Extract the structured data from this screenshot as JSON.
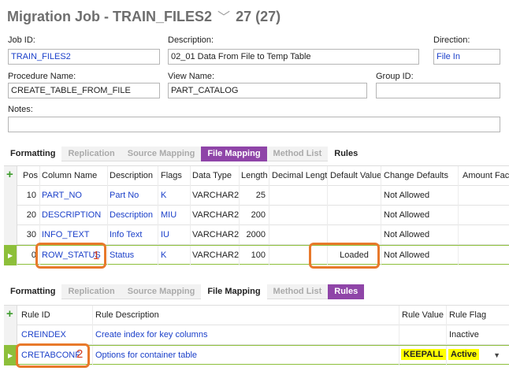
{
  "header": {
    "title": "Migration Job - TRAIN_FILES2",
    "chevron": "﹀",
    "count": "27 (27)"
  },
  "form": {
    "job_id_label": "Job ID:",
    "job_id": "TRAIN_FILES2",
    "description_label": "Description:",
    "description": "02_01 Data From File to Temp Table",
    "direction_label": "Direction:",
    "direction": "File In",
    "procedure_label": "Procedure Name:",
    "procedure": "CREATE_TABLE_FROM_FILE",
    "view_label": "View Name:",
    "view": "PART_CATALOG",
    "group_label": "Group ID:",
    "group": "",
    "notes_label": "Notes:",
    "notes": ""
  },
  "tabs1": [
    "Formatting",
    "Replication",
    "Source Mapping",
    "File Mapping",
    "Method List",
    "Rules"
  ],
  "tabs2": [
    "Formatting",
    "Replication",
    "Source Mapping",
    "File Mapping",
    "Method List",
    "Rules"
  ],
  "mapping": {
    "headers": [
      "Pos",
      "Column Name",
      "Description",
      "Flags",
      "Data Type",
      "Length",
      "Decimal Length",
      "Default Value",
      "Change Defaults",
      "Amount Fact"
    ],
    "rows": [
      [
        "10",
        "PART_NO",
        "Part No",
        "K",
        "VARCHAR2",
        "25",
        "",
        "",
        "Not Allowed"
      ],
      [
        "20",
        "DESCRIPTION",
        "Description",
        "MIU",
        "VARCHAR2",
        "200",
        "",
        "",
        "Not Allowed"
      ],
      [
        "30",
        "INFO_TEXT",
        "Info Text",
        "IU",
        "VARCHAR2",
        "2000",
        "",
        "",
        "Not Allowed"
      ],
      [
        "0",
        "ROW_STATUS",
        "Status",
        "K",
        "VARCHAR2",
        "100",
        "",
        "Loaded",
        "Not Allowed"
      ]
    ]
  },
  "rules": {
    "headers": [
      "Rule ID",
      "Rule Description",
      "Rule Value",
      "Rule Flag"
    ],
    "rows": [
      [
        "CREINDEX",
        "Create index for key columns",
        "",
        "Inactive"
      ],
      [
        "CRETABCONF",
        "Options for container table",
        "KEEPALL",
        "Active"
      ]
    ]
  },
  "callouts": {
    "one": "1",
    "two": "2"
  },
  "icons": {
    "add": "+",
    "row_marker": "▶",
    "dropdown": "▼"
  },
  "colors": {
    "selected_tab": "#8f45a8",
    "active_row": "#8dbf3a",
    "callout": "#e8792b",
    "highlight": "#ffff00"
  }
}
